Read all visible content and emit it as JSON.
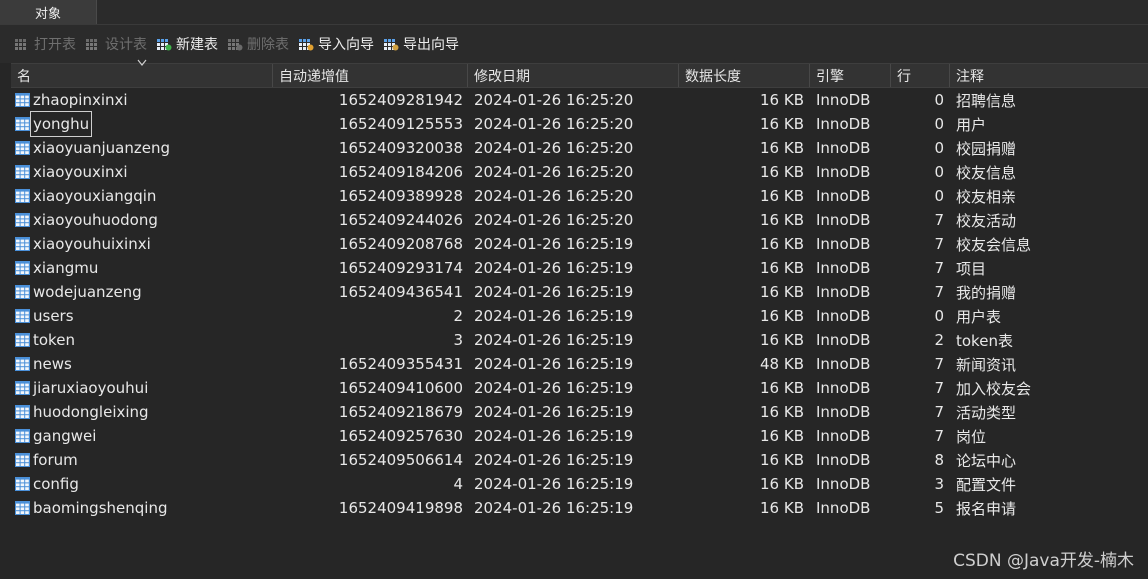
{
  "tabs": [
    {
      "label": "对象"
    }
  ],
  "toolbar": {
    "buttons": [
      {
        "label": "打开表",
        "icon": "open-table-icon",
        "enabled": false
      },
      {
        "label": "设计表",
        "icon": "design-table-icon",
        "enabled": false
      },
      {
        "label": "新建表",
        "icon": "new-table-icon",
        "enabled": true
      },
      {
        "label": "删除表",
        "icon": "delete-table-icon",
        "enabled": false
      },
      {
        "label": "导入向导",
        "icon": "import-wizard-icon",
        "enabled": true
      },
      {
        "label": "导出向导",
        "icon": "export-wizard-icon",
        "enabled": true
      }
    ]
  },
  "table": {
    "columns": [
      "名",
      "自动递增值",
      "修改日期",
      "数据长度",
      "引擎",
      "行",
      "注释"
    ],
    "sort_column": "名",
    "rows": [
      {
        "name": "zhaopinxinxi",
        "auto_inc": "1652409281942",
        "modified": "2024-01-26 16:25:20",
        "size": "16 KB",
        "engine": "InnoDB",
        "rows": "0",
        "comment": "招聘信息"
      },
      {
        "name": "yonghu",
        "auto_inc": "1652409125553",
        "modified": "2024-01-26 16:25:20",
        "size": "16 KB",
        "engine": "InnoDB",
        "rows": "0",
        "comment": "用户",
        "selected": true
      },
      {
        "name": "xiaoyuanjuanzeng",
        "auto_inc": "1652409320038",
        "modified": "2024-01-26 16:25:20",
        "size": "16 KB",
        "engine": "InnoDB",
        "rows": "0",
        "comment": "校园捐赠"
      },
      {
        "name": "xiaoyouxinxi",
        "auto_inc": "1652409184206",
        "modified": "2024-01-26 16:25:20",
        "size": "16 KB",
        "engine": "InnoDB",
        "rows": "0",
        "comment": "校友信息"
      },
      {
        "name": "xiaoyouxiangqin",
        "auto_inc": "1652409389928",
        "modified": "2024-01-26 16:25:20",
        "size": "16 KB",
        "engine": "InnoDB",
        "rows": "0",
        "comment": "校友相亲"
      },
      {
        "name": "xiaoyouhuodong",
        "auto_inc": "1652409244026",
        "modified": "2024-01-26 16:25:20",
        "size": "16 KB",
        "engine": "InnoDB",
        "rows": "7",
        "comment": "校友活动"
      },
      {
        "name": "xiaoyouhuixinxi",
        "auto_inc": "1652409208768",
        "modified": "2024-01-26 16:25:19",
        "size": "16 KB",
        "engine": "InnoDB",
        "rows": "7",
        "comment": "校友会信息"
      },
      {
        "name": "xiangmu",
        "auto_inc": "1652409293174",
        "modified": "2024-01-26 16:25:19",
        "size": "16 KB",
        "engine": "InnoDB",
        "rows": "7",
        "comment": "项目"
      },
      {
        "name": "wodejuanzeng",
        "auto_inc": "1652409436541",
        "modified": "2024-01-26 16:25:19",
        "size": "16 KB",
        "engine": "InnoDB",
        "rows": "7",
        "comment": "我的捐赠"
      },
      {
        "name": "users",
        "auto_inc": "2",
        "modified": "2024-01-26 16:25:19",
        "size": "16 KB",
        "engine": "InnoDB",
        "rows": "0",
        "comment": "用户表"
      },
      {
        "name": "token",
        "auto_inc": "3",
        "modified": "2024-01-26 16:25:19",
        "size": "16 KB",
        "engine": "InnoDB",
        "rows": "2",
        "comment": "token表"
      },
      {
        "name": "news",
        "auto_inc": "1652409355431",
        "modified": "2024-01-26 16:25:19",
        "size": "48 KB",
        "engine": "InnoDB",
        "rows": "7",
        "comment": "新闻资讯"
      },
      {
        "name": "jiaruxiaoyouhui",
        "auto_inc": "1652409410600",
        "modified": "2024-01-26 16:25:19",
        "size": "16 KB",
        "engine": "InnoDB",
        "rows": "7",
        "comment": "加入校友会"
      },
      {
        "name": "huodongleixing",
        "auto_inc": "1652409218679",
        "modified": "2024-01-26 16:25:19",
        "size": "16 KB",
        "engine": "InnoDB",
        "rows": "7",
        "comment": "活动类型"
      },
      {
        "name": "gangwei",
        "auto_inc": "1652409257630",
        "modified": "2024-01-26 16:25:19",
        "size": "16 KB",
        "engine": "InnoDB",
        "rows": "7",
        "comment": "岗位"
      },
      {
        "name": "forum",
        "auto_inc": "1652409506614",
        "modified": "2024-01-26 16:25:19",
        "size": "16 KB",
        "engine": "InnoDB",
        "rows": "8",
        "comment": "论坛中心"
      },
      {
        "name": "config",
        "auto_inc": "4",
        "modified": "2024-01-26 16:25:19",
        "size": "16 KB",
        "engine": "InnoDB",
        "rows": "3",
        "comment": "配置文件"
      },
      {
        "name": "baomingshenqing",
        "auto_inc": "1652409419898",
        "modified": "2024-01-26 16:25:19",
        "size": "16 KB",
        "engine": "InnoDB",
        "rows": "5",
        "comment": "报名申请"
      }
    ]
  },
  "watermark": "CSDN @Java开发-楠木",
  "colors": {
    "background": "#262626",
    "table_icon": "#4a90d9",
    "toolbar_icon_enabled": "#5aa0e8"
  }
}
